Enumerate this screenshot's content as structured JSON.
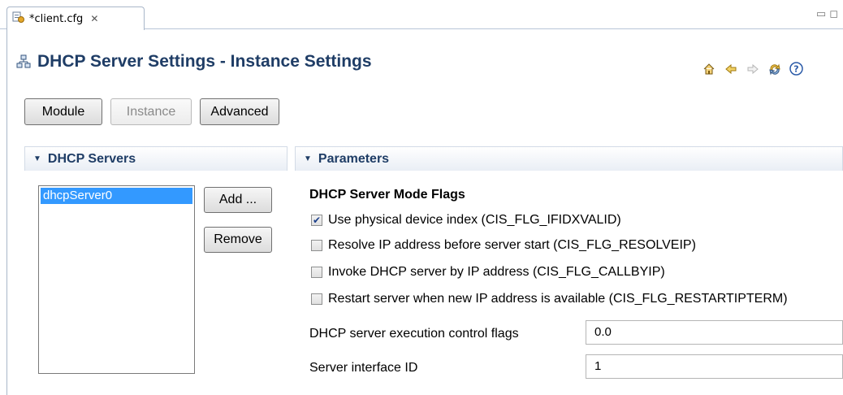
{
  "tab": {
    "label": "*client.cfg",
    "close_glyph": "✕"
  },
  "page": {
    "title": "DHCP Server Settings - Instance Settings"
  },
  "nav_icons": [
    "home-icon",
    "back-icon",
    "forward-icon",
    "refresh-icon",
    "help-icon"
  ],
  "toolbar": {
    "module": "Module",
    "instance": "Instance",
    "advanced": "Advanced"
  },
  "servers_section": {
    "title": "DHCP Servers",
    "items": [
      "dhcpServer0"
    ],
    "add_label": "Add ...",
    "remove_label": "Remove"
  },
  "params_section": {
    "title": "Parameters",
    "group_title": "DHCP Server Mode Flags",
    "flags": [
      {
        "label": "Use physical device index (CIS_FLG_IFIDXVALID)",
        "checked": true
      },
      {
        "label": "Resolve IP address before server start (CIS_FLG_RESOLVEIP)",
        "checked": false
      },
      {
        "label": "Invoke DHCP server by IP address (CIS_FLG_CALLBYIP)",
        "checked": false
      },
      {
        "label": "Restart server when new IP address is available (CIS_FLG_RESTARTIPTERM)",
        "checked": false
      }
    ],
    "fields": [
      {
        "label": "DHCP server execution control flags",
        "value": "0.0"
      },
      {
        "label": "Server interface ID",
        "value": "1"
      }
    ]
  },
  "colors": {
    "title": "#1f3d66",
    "selection": "#3399ff"
  }
}
